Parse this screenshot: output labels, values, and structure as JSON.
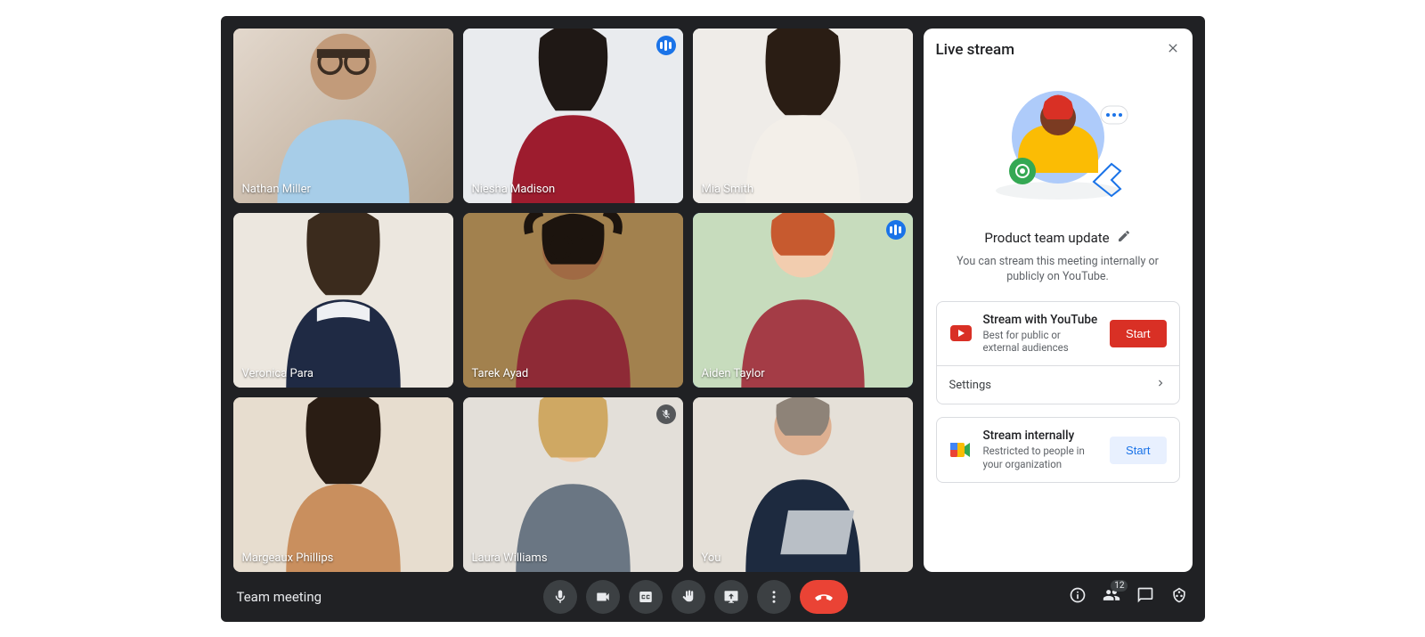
{
  "meeting": {
    "title": "Team meeting",
    "participant_count": "12"
  },
  "participants": [
    {
      "name": "Nathan Miller",
      "speaking": false,
      "muted": false,
      "active": false
    },
    {
      "name": "Niesha Madison",
      "speaking": true,
      "muted": false,
      "active": false
    },
    {
      "name": "Mia Smith",
      "speaking": false,
      "muted": false,
      "active": false
    },
    {
      "name": "Veronica Para",
      "speaking": false,
      "muted": false,
      "active": false
    },
    {
      "name": "Tarek Ayad",
      "speaking": false,
      "muted": false,
      "active": false
    },
    {
      "name": "Aiden Taylor",
      "speaking": true,
      "muted": false,
      "active": true
    },
    {
      "name": "Margeaux Phillips",
      "speaking": false,
      "muted": false,
      "active": false
    },
    {
      "name": "Laura Williams",
      "speaking": false,
      "muted": true,
      "active": false
    },
    {
      "name": "You",
      "speaking": false,
      "muted": false,
      "active": false
    }
  ],
  "panel": {
    "title": "Live stream",
    "stream_title": "Product team update",
    "description": "You can stream this meeting internally or publicly on YouTube.",
    "youtube": {
      "title": "Stream with YouTube",
      "subtitle": "Best for public or external audiences",
      "button": "Start"
    },
    "settings_label": "Settings",
    "internal": {
      "title": "Stream internally",
      "subtitle": "Restricted to people in your organization",
      "button": "Start"
    }
  }
}
